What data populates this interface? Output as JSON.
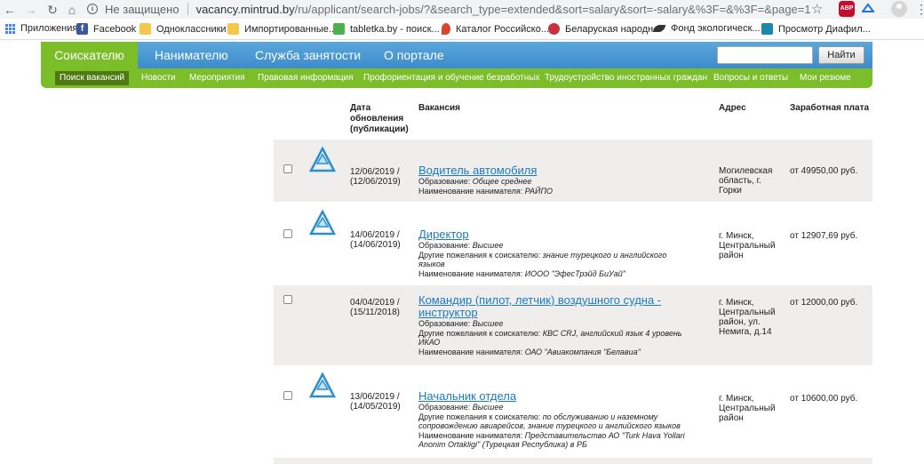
{
  "browser": {
    "security_label": "Не защищено",
    "url_domain": "vacancy.mintrud.by",
    "url_path": "/ru/applicant/search-jobs/?&search_type=extended&sort=salary&sort=-salary&%3F=&%3F=&page=1",
    "extension_abp_label": "ABP"
  },
  "bookmarks": [
    {
      "label": "Приложения",
      "icon": "apps-grid-icon",
      "color": "#4285f4"
    },
    {
      "label": "Facebook",
      "icon": "facebook-icon",
      "color": "#3b5998"
    },
    {
      "label": "Одноклассники",
      "icon": "folder-icon",
      "color": "#f2c94c"
    },
    {
      "label": "Импортированные...",
      "icon": "folder-icon",
      "color": "#f2c94c"
    },
    {
      "label": "tabletka.by - поиск...",
      "icon": "tabletka-icon",
      "color": "#4caf50"
    },
    {
      "label": "Каталог Российско...",
      "icon": "map-pin-icon",
      "color": "#d9432f"
    },
    {
      "label": "Беларуская народн...",
      "icon": "belarus-flag-icon",
      "color": "#c8313e"
    },
    {
      "label": "Фонд экологическ...",
      "icon": "bird-icon",
      "color": "#333333"
    },
    {
      "label": "Просмотр Диафил...",
      "icon": "film-icon",
      "color": "#1e88a8"
    }
  ],
  "topnav": {
    "tabs": [
      "Соискателю",
      "Нанимателю",
      "Служба занятости",
      "О портале"
    ],
    "search_value": "",
    "search_button": "Найти"
  },
  "subnav": [
    "Поиск вакансий",
    "Новости",
    "Мероприятия",
    "Правовая информация",
    "Профориентация и обучение безработных",
    "Трудоустройство иностранных граждан",
    "Вопросы и ответы",
    "Мои резюме"
  ],
  "table": {
    "headers": {
      "date": [
        "Дата",
        "обновления",
        "(публикации)"
      ],
      "vacancy": "Вакансия",
      "address": "Адрес",
      "salary": "Заработная плата"
    },
    "rows": [
      {
        "date": "12/06/2019 /",
        "date2": "(12/06/2019)",
        "title": "Водитель автомобиля",
        "lines": [
          {
            "label": "Образование: ",
            "value": "Общее среднее"
          },
          {
            "label": "Наименование нанимателя: ",
            "value": "РАЙПО"
          }
        ],
        "address": [
          "Могилевская",
          "область, г.",
          "Горки"
        ],
        "salary": "от 49950,00 руб."
      },
      {
        "date": "14/06/2019 /",
        "date2": "(14/06/2019)",
        "title": "Директор",
        "lines": [
          {
            "label": "Образование: ",
            "value": "Высшее"
          },
          {
            "label": "Другие пожелания к соискателю: ",
            "value": "знание турецкого и английского"
          },
          {
            "label": "",
            "value": "языков"
          },
          {
            "label": "Наименование нанимателя: ",
            "value": "ИОOO \"ЭфесТрэйд БиУай\""
          }
        ],
        "address": [
          "г. Минск,",
          "Центральный",
          "район"
        ],
        "salary": "от 12907,69 руб."
      },
      {
        "date": "04/04/2019 /",
        "date2": "(15/11/2018)",
        "title": "Командир (пилот, летчик) воздушного судна -",
        "title2": "инструктор",
        "lines": [
          {
            "label": "Образование: ",
            "value": "Высшее"
          },
          {
            "label": "Другие пожелания к соискателю: ",
            "value": "КВС CRJ, английский язык 4 уровень"
          },
          {
            "label": "",
            "value": "ИКАО"
          },
          {
            "label": "Наименование нанимателя: ",
            "value": "ОАО \"Авиакомпания \"Белавиа\""
          }
        ],
        "address": [
          "г. Минск,",
          "Центральный",
          "район, ул.",
          "Немига, д.14"
        ],
        "salary": "от 12000,00 руб."
      },
      {
        "date": "13/06/2019 /",
        "date2": "(14/05/2019)",
        "title": "Начальник отдела",
        "lines": [
          {
            "label": "Образование: ",
            "value": "Высшее"
          },
          {
            "label": "Другие пожелания к соискателю: ",
            "value": "по обслуживанию и наземному"
          },
          {
            "label": "",
            "value": "сопровождению авиарейсов, знание турецкого и английского языков"
          },
          {
            "label": "Наименование нанимателя: ",
            "value": "Представительство АО \"Turk Hava Yollari"
          },
          {
            "label": "",
            "value": "Anonim Ortakligi\" (Турецкая Республика) в РБ"
          }
        ],
        "address": [
          "г. Минск,",
          "Центральный",
          "район"
        ],
        "salary": "от 10600,00 руб."
      }
    ]
  }
}
